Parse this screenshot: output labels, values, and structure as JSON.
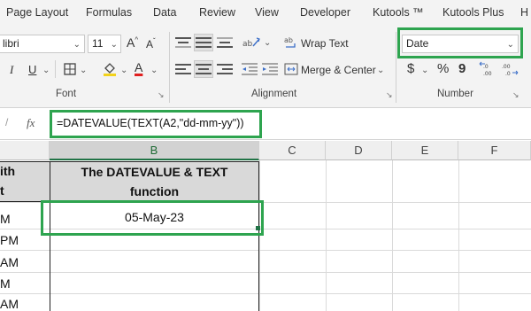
{
  "tabs": [
    "Page Layout",
    "Formulas",
    "Data",
    "Review",
    "View",
    "Developer",
    "Kutools ™",
    "Kutools Plus",
    "H"
  ],
  "font": {
    "name": "libri",
    "size": "11",
    "grow_label": "A",
    "shrink_label": "A",
    "italic_label": "I",
    "underline_label": "U",
    "color_label": "A",
    "group_label": "Font"
  },
  "alignment": {
    "wrap_text_label": "Wrap Text",
    "merge_label": "Merge & Center",
    "group_label": "Alignment"
  },
  "number": {
    "format_value": "Date",
    "currency_symbol": "$",
    "percent_symbol": "%",
    "comma_symbol": "9",
    "group_label": "Number"
  },
  "formula_bar": {
    "fx_label": "fx",
    "formula": "=DATEVALUE(TEXT(A2,\"dd-mm-yy\"))"
  },
  "columns": [
    "B",
    "C",
    "D",
    "E",
    "F"
  ],
  "column_a_fragments": [
    "ith",
    "t",
    "M",
    "PM",
    "AM",
    "M",
    "AM"
  ],
  "header_cell": "The DATEVALUE & TEXT function",
  "result_cell": "05-May-23",
  "colors": {
    "ribbon": "#f3f3f3",
    "highlight": "#2ea44f",
    "selected_header": "#d2d2d2"
  }
}
